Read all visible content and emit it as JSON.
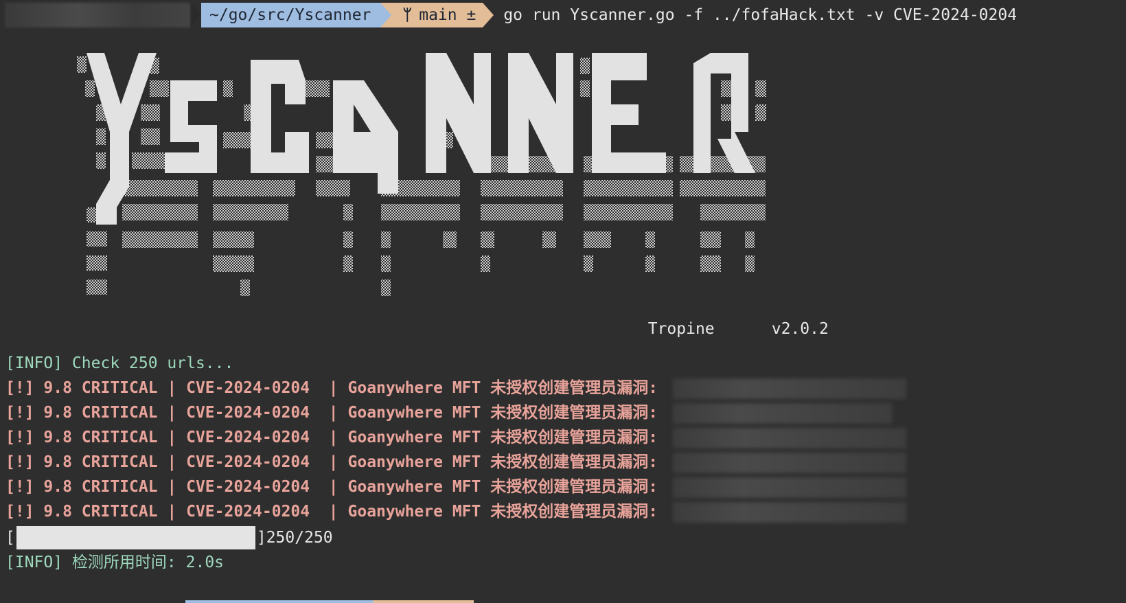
{
  "prompt": {
    "directory": "~/go/src/Yscanner",
    "branch_icon": "git-branch-icon",
    "branch": "main ±",
    "command": "go run Yscanner.go -f ../fofaHack.txt -v CVE-2024-0204"
  },
  "banner": {
    "logo_text": "YSCANNER",
    "author": "Tropine",
    "version": "v2.0.2"
  },
  "output": {
    "info_check": "[INFO] Check 250 urls...",
    "results": [
      "[!] 9.8 CRITICAL | CVE-2024-0204  | Goanywhere MFT 未授权创建管理员漏洞:",
      "[!] 9.8 CRITICAL | CVE-2024-0204  | Goanywhere MFT 未授权创建管理员漏洞:",
      "[!] 9.8 CRITICAL | CVE-2024-0204  | Goanywhere MFT 未授权创建管理员漏洞:",
      "[!] 9.8 CRITICAL | CVE-2024-0204  | Goanywhere MFT 未授权创建管理员漏洞:",
      "[!] 9.8 CRITICAL | CVE-2024-0204  | Goanywhere MFT 未授权创建管理员漏洞:",
      "[!] 9.8 CRITICAL | CVE-2024-0204  | Goanywhere MFT 未授权创建管理员漏洞:"
    ],
    "progress": {
      "open": "[",
      "close": "]250/250",
      "fraction": 1.0
    },
    "info_time": "[INFO] 检测所用时间: 2.0s"
  },
  "colors": {
    "background": "#2e2e2e",
    "dir_segment": "#9ebde0",
    "git_segment": "#e2bd98",
    "info_text": "#9ed9bd",
    "critical_text": "#e8a39a"
  }
}
